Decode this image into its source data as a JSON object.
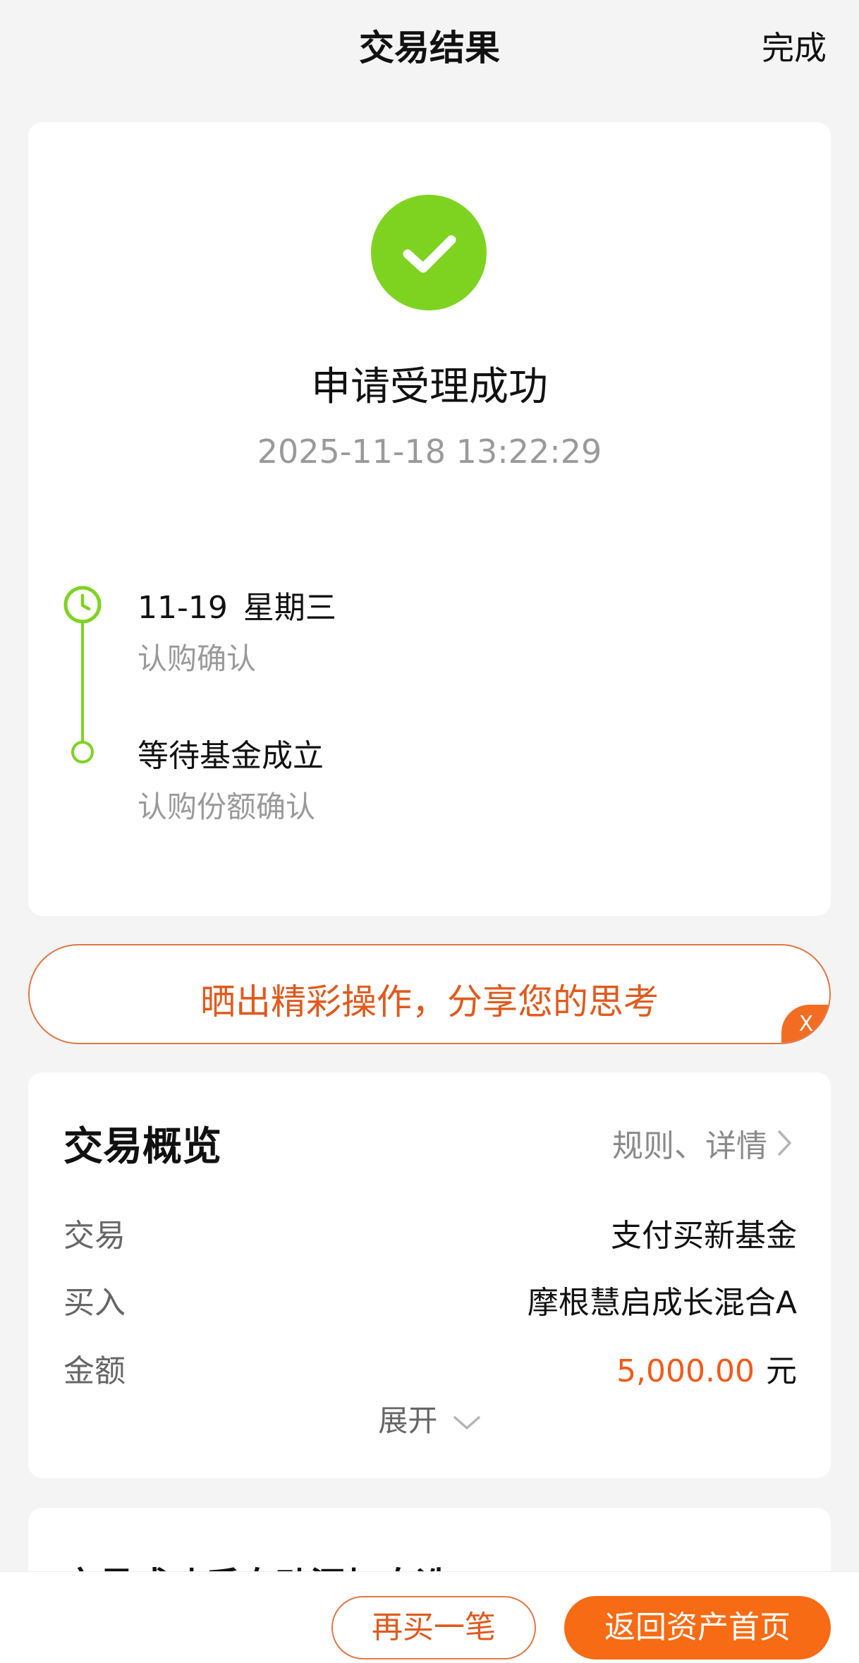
{
  "header": {
    "title": "交易结果",
    "done_label": "完成"
  },
  "result": {
    "title": "申请受理成功",
    "timestamp": "2025-11-18 13:22:29",
    "status_color": "#7ed321",
    "timeline": [
      {
        "date": "11-19",
        "weekday": "星期三",
        "desc": "认购确认",
        "icon": "clock-icon"
      },
      {
        "title": "等待基金成立",
        "desc": "认购份额确认",
        "icon": "dot-icon"
      }
    ]
  },
  "share": {
    "text": "晒出精彩操作，分享您的思考",
    "close_label": "X"
  },
  "overview": {
    "title": "交易概览",
    "link_label": "规则、详情",
    "rows": [
      {
        "label": "交易",
        "value": "支付买新基金"
      },
      {
        "label": "买入",
        "value": "摩根慧启成长混合A"
      },
      {
        "label": "金额",
        "amount": "5,000.00",
        "unit": "元"
      }
    ],
    "expand_label": "展开",
    "accent_color": "#f25a1a"
  },
  "next_card": {
    "title": "交易成功后自动添加自选"
  },
  "actions": {
    "buy_again_label": "再买一笔",
    "home_label": "返回资产首页"
  }
}
